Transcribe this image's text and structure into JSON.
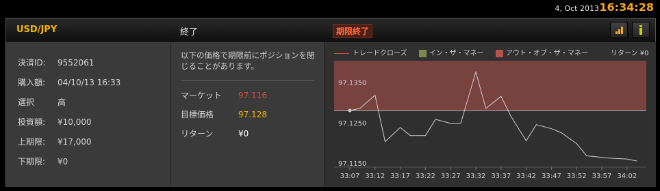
{
  "topbar": {
    "date": "4, Oct 2013",
    "time": "16:34:28"
  },
  "header": {
    "pair": "USD/JPY",
    "status": "終了",
    "expired_badge": "期限終了"
  },
  "details": [
    {
      "label": "決済ID:",
      "value": "9552061"
    },
    {
      "label": "購入額:",
      "value": "04/10/13 16:33"
    },
    {
      "label": "選択",
      "value": "高"
    },
    {
      "label": "投資額:",
      "value": "¥10,000"
    },
    {
      "label": "上期限:",
      "value": "¥17,000"
    },
    {
      "label": "下期限:",
      "value": "¥0"
    }
  ],
  "market": {
    "note": "以下の価格で期限前にポジションを閉じることがあります。",
    "market_label": "マーケット",
    "market_value": "97.116",
    "target_label": "目標価格",
    "target_value": "97.128",
    "return_label": "リターン",
    "return_value": "¥0"
  },
  "legend": {
    "trade_close": "トレードクローズ",
    "in_money": "イン・ザ・マネー",
    "out_money": "アウト・オブ・ザ・マネー",
    "return": "リターン ¥0"
  },
  "chart_data": {
    "type": "line",
    "y_ticks": [
      "97.1350",
      "97.1250",
      "97.1150"
    ],
    "x_ticks": [
      "33:07",
      "33:12",
      "33:17",
      "33:22",
      "33:27",
      "33:32",
      "33:37",
      "33:42",
      "33:47",
      "33:52",
      "33:57",
      "34:02"
    ],
    "ylim": [
      97.114,
      97.1403
    ],
    "target": 97.128,
    "zones": {
      "above_target": "out_of_money",
      "below_target": "in_money"
    },
    "series": [
      {
        "x": [
          "33:07",
          "33:09",
          "33:12",
          "33:14",
          "33:17",
          "33:19",
          "33:22",
          "33:24",
          "33:27",
          "33:29",
          "33:32",
          "33:34",
          "33:37",
          "33:39",
          "33:42",
          "33:44",
          "33:47",
          "33:49",
          "33:52",
          "33:54",
          "33:57",
          "33:59",
          "34:02",
          "34:04"
        ],
        "values": [
          97.128,
          97.1285,
          97.1318,
          97.1203,
          97.1238,
          97.1218,
          97.1218,
          97.1258,
          97.1248,
          97.1248,
          97.1375,
          97.1285,
          97.1315,
          97.1265,
          97.1205,
          97.1245,
          97.1235,
          97.1225,
          97.1198,
          97.1168,
          97.1164,
          97.1162,
          97.116,
          97.1155
        ]
      }
    ],
    "grid": false
  },
  "colors": {
    "accent": "#f5b400",
    "clock": "#f5a623",
    "out_zone": "#b3534c",
    "in_zone": "#7c8850",
    "expired": "#ff6a3c"
  }
}
